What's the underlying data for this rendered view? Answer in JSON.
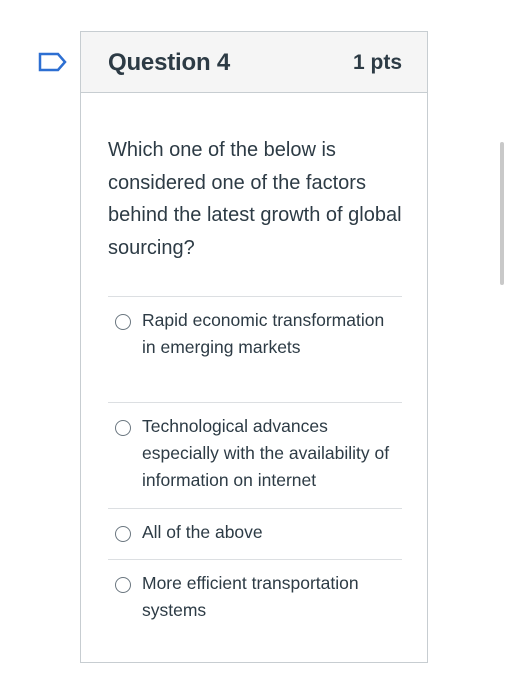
{
  "question": {
    "title": "Question 4",
    "points": "1 pts",
    "text": "Which one of the below is considered one of the factors behind the latest growth of global sourcing?"
  },
  "answers": [
    {
      "label": "Rapid economic transformation in emerging markets",
      "selected": false
    },
    {
      "label": "Technological advances especially with the availability of information on internet",
      "selected": false
    },
    {
      "label": "All of the above",
      "selected": false
    },
    {
      "label": "More efficient transportation systems",
      "selected": false
    }
  ],
  "colors": {
    "flag": "#2d6fd2",
    "text": "#2d3b45",
    "header_bg": "#f5f5f5",
    "border": "#c7cdd1"
  },
  "icons": {
    "flag": "bookmark-flag-icon",
    "radio": "radio-unchecked-icon"
  }
}
